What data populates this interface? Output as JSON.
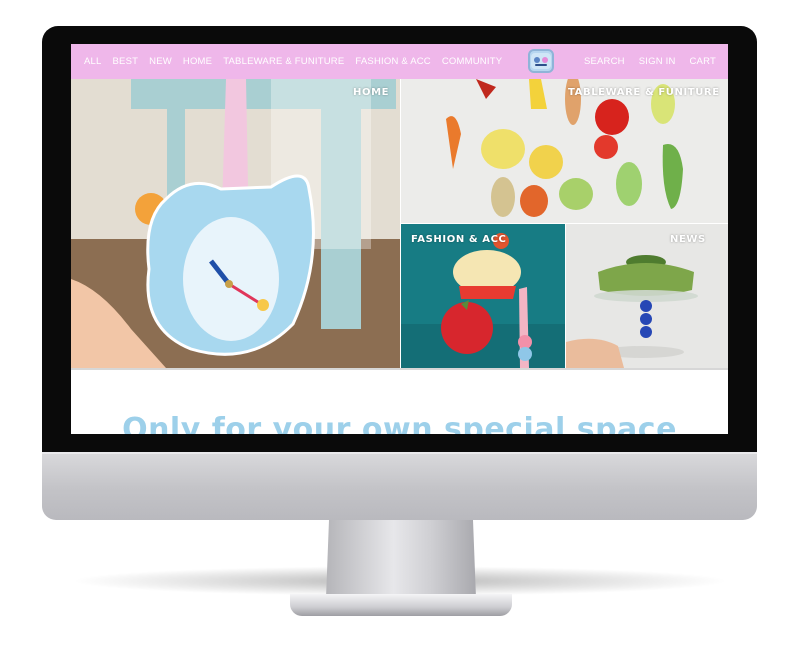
{
  "nav": {
    "left_items": [
      "ALL",
      "BEST",
      "NEW",
      "HOME",
      "TABLEWARE & FUNITURE",
      "FASHION & ACC",
      "COMMUNITY"
    ],
    "right_items": [
      "SEARCH",
      "SIGN IN",
      "CART"
    ],
    "logo_text": ""
  },
  "tiles": {
    "home": "HOME",
    "tableware": "TABLEWARE & FUNITURE",
    "fashion": "FASHION & ACC",
    "news": "NEWS"
  },
  "headline": "Only for your own special space",
  "colors": {
    "nav_bg": "#efb7ea",
    "headline": "#9dd0ea",
    "bezel": "#0a0a0a"
  }
}
